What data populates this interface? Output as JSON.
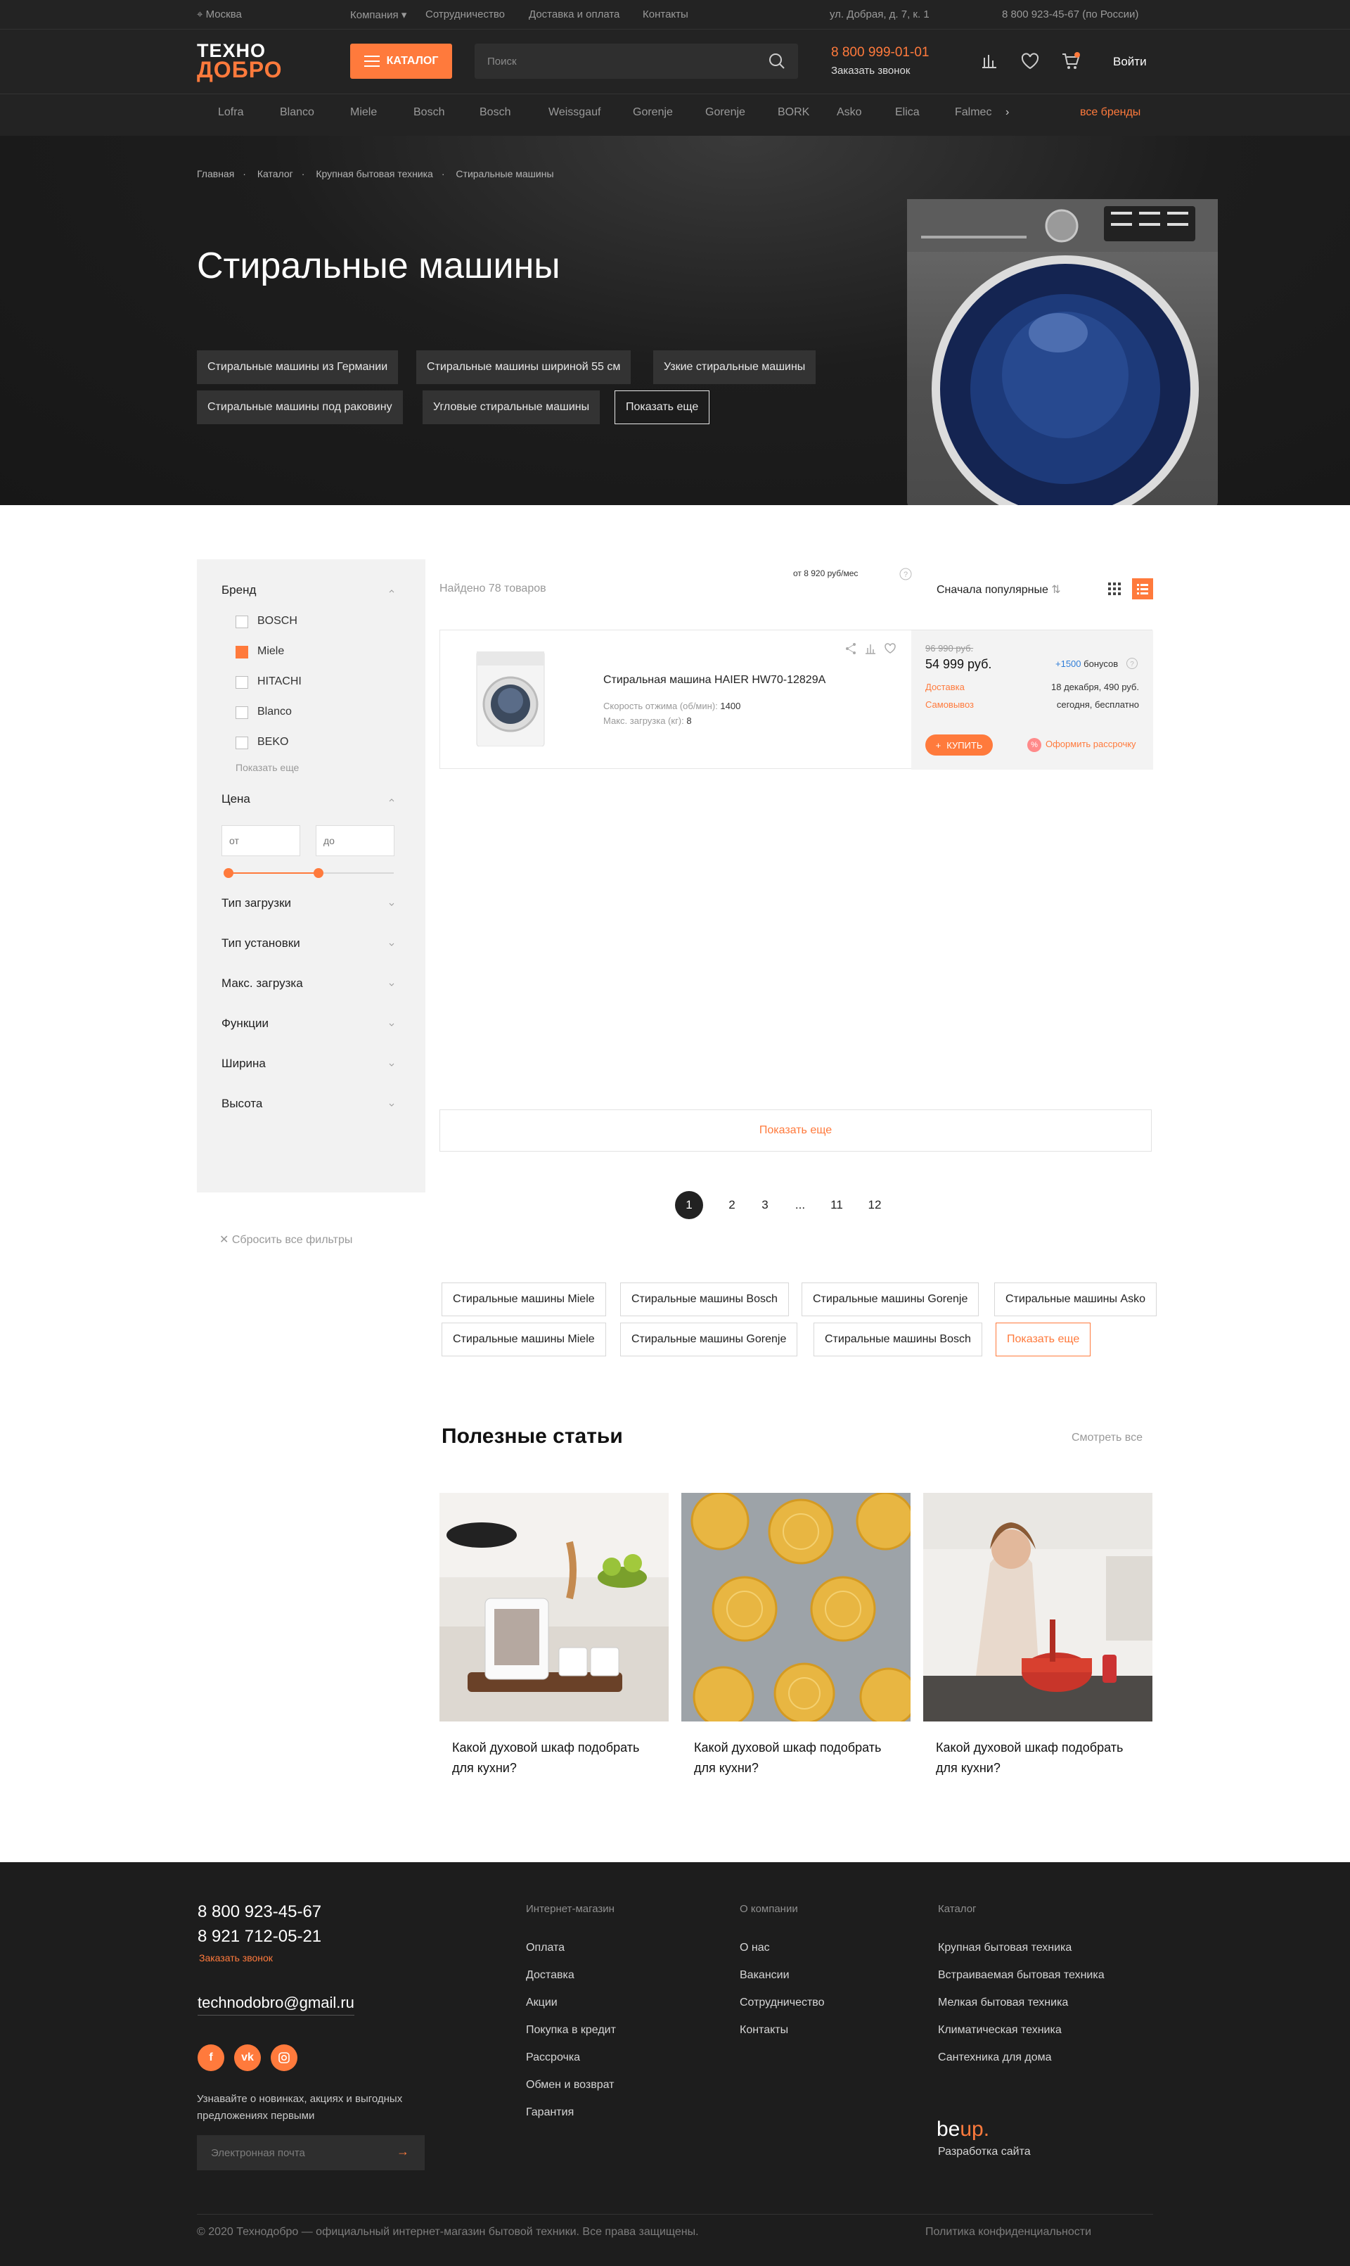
{
  "colors": {
    "accent": "#ff7a3c",
    "dark": "#232323",
    "footer": "#1d1d1d"
  },
  "topbar": {
    "city": "Москва",
    "links": [
      "Компания",
      "Сотрудничество",
      "Доставка и оплата",
      "Контакты"
    ],
    "address": "ул. Добрая, д. 7, к. 1",
    "phone": "8 800 923-45-67 (по России)"
  },
  "header": {
    "logo_top": "ТЕХНО",
    "logo_bottom": "ДОБРО",
    "catalog_label": "КАТАЛОГ",
    "search_placeholder": "Поиск",
    "phone": "8 800 999-01-01",
    "call_request": "Заказать звонок",
    "login": "Войти",
    "icons": [
      "compare-icon",
      "heart-icon",
      "cart-icon"
    ]
  },
  "brands": {
    "items": [
      "Lofra",
      "Blanco",
      "Miele",
      "Bosch",
      "Bosch",
      "Weissgauf",
      "Gorenje",
      "Gorenje",
      "BORK",
      "Asko",
      "Elica",
      "Falmec"
    ],
    "all": "все бренды"
  },
  "hero": {
    "breadcrumbs": [
      "Главная",
      "Каталог",
      "Крупная бытовая техника",
      "Стиральные машины"
    ],
    "title": "Стиральные машины",
    "tags": [
      "Стиральные машины из Германии",
      "Стиральные машины шириной 55 см",
      "Узкие стиральные машины",
      "Стиральные машины под раковину",
      "Угловые стиральные машины",
      "Показать еще"
    ]
  },
  "filters": {
    "brand_title": "Бренд",
    "brands": [
      {
        "label": "BOSCH",
        "checked": false
      },
      {
        "label": "Miele",
        "checked": true
      },
      {
        "label": "HITACHI",
        "checked": false
      },
      {
        "label": "Blanco",
        "checked": false
      },
      {
        "label": "BEKO",
        "checked": false
      }
    ],
    "show_more": "Показать еще",
    "price_title": "Цена",
    "price_from": "от",
    "price_to": "до",
    "price_range": [
      0.0,
      0.55
    ],
    "sections": [
      "Тип загрузки",
      "Тип установки",
      "Макс. загрузка",
      "Функции",
      "Ширина",
      "Высота"
    ],
    "reset": "Сбросить все фильтры"
  },
  "listing": {
    "found": "Найдено 78 товаров",
    "from_price": "от 8 920 руб/мес",
    "sort": "Сначала популярные",
    "show_more": "Показать еще",
    "pages": [
      "1",
      "2",
      "3",
      "...",
      "11",
      "12"
    ]
  },
  "product": {
    "title": "Стиральная машина HAIER HW70-12829A",
    "spin_label": "Скорость отжима (об/мин):",
    "spin_value": "1400",
    "load_label": "Макс. загрузка (кг):",
    "load_value": "8",
    "old_price": "96 990 руб.",
    "price": "54 999 руб.",
    "bonus_value": "+1500",
    "bonus_label": "бонусов",
    "delivery_label": "Доставка",
    "delivery_value": "18 декабря, 490 руб.",
    "pickup_label": "Самовывоз",
    "pickup_value": "сегодня, бесплатно",
    "buy": "КУПИТЬ",
    "installment": "Оформить рассрочку"
  },
  "links": {
    "tags": [
      "Стиральные машины Miele",
      "Стиральные машины Bosch",
      "Стиральные машины Gorenje",
      "Стиральные машины Asko",
      "Стиральные машины Miele",
      "Стиральные машины Gorenje",
      "Стиральные машины Bosch",
      "Показать еще"
    ]
  },
  "articles": {
    "title": "Полезные статьи",
    "see_all": "Смотреть все",
    "items": [
      {
        "title": "Какой духовой шкаф подобрать для кухни?"
      },
      {
        "title": "Какой духовой шкаф подобрать для кухни?"
      },
      {
        "title": "Какой духовой шкаф подобрать для кухни?"
      }
    ]
  },
  "footer": {
    "phone1": "8 800 923-45-67",
    "phone2": "8 921 712-05-21",
    "call_request": "Заказать звонок",
    "email": "technodobro@gmail.ru",
    "social": [
      "facebook-icon",
      "vk-icon",
      "instagram-icon"
    ],
    "subscribe_text": "Узнавайте о новинках, акциях и выгодных предложениях первыми",
    "email_placeholder": "Электронная почта",
    "shop_title": "Интернет-магазин",
    "shop_links": [
      "Оплата",
      "Доставка",
      "Акции",
      "Покупка в кредит",
      "Рассрочка",
      "Обмен и возврат",
      "Гарантия"
    ],
    "company_title": "О компании",
    "company_links": [
      "О нас",
      "Вакансии",
      "Сотрудничество",
      "Контакты"
    ],
    "catalog_title": "Каталог",
    "catalog_links": [
      "Крупная бытовая техника",
      "Встраиваемая бытовая техника",
      "Мелкая бытовая техника",
      "Климатическая техника",
      "Сантехника для дома"
    ],
    "dev_logo_a": "be",
    "dev_logo_b": "up.",
    "dev_text": "Разработка сайта",
    "copyright": "© 2020 Технодобро — официальный интернет-магазин бытовой техники. Все права защищены.",
    "privacy": "Политика конфиденциальности"
  }
}
